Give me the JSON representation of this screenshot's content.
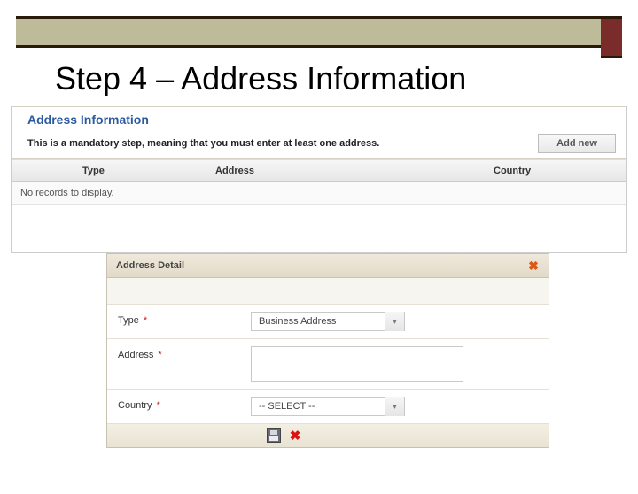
{
  "slide": {
    "title": "Step 4 – Address Information"
  },
  "section": {
    "heading": "Address Information",
    "mandatory_msg": "This is a mandatory step, meaning that you must enter at least one address.",
    "add_new_label": "Add new"
  },
  "table": {
    "columns": {
      "type": "Type",
      "address": "Address",
      "country": "Country"
    },
    "empty_msg": "No records to display."
  },
  "detail": {
    "title": "Address Detail",
    "fields": {
      "type": {
        "label": "Type",
        "required_marker": "*",
        "value": "Business Address"
      },
      "address": {
        "label": "Address",
        "required_marker": "*",
        "value": ""
      },
      "country": {
        "label": "Country",
        "required_marker": "*",
        "value": "-- SELECT --"
      }
    }
  }
}
